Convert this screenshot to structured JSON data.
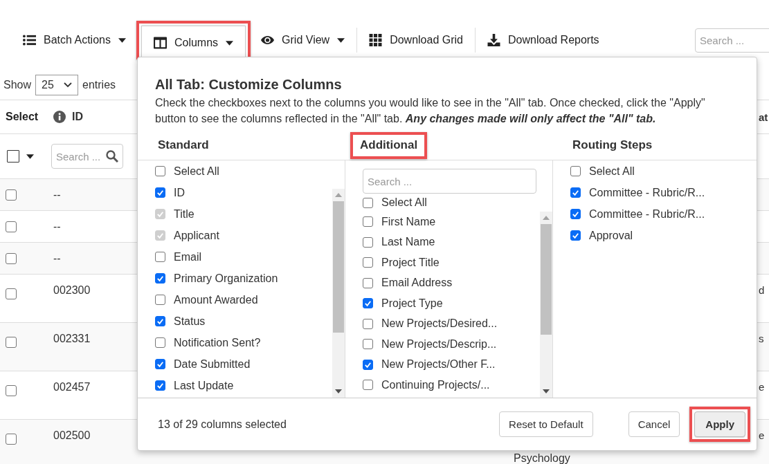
{
  "toolbar": {
    "items": [
      {
        "label": "Batch Actions",
        "caret": true,
        "highlighted": false,
        "separator": false
      },
      {
        "label": "Columns",
        "caret": true,
        "highlighted": true,
        "separator": false
      },
      {
        "label": "Grid View",
        "caret": true,
        "highlighted": false,
        "separator": false
      },
      {
        "label": "Download Grid",
        "caret": false,
        "highlighted": false,
        "separator": true
      },
      {
        "label": "Download Reports",
        "caret": false,
        "highlighted": false,
        "separator": true
      }
    ],
    "search": {
      "placeholder": "Search ..."
    }
  },
  "length_menu": {
    "prefix": "Show",
    "value": "25",
    "suffix": "entries"
  },
  "table": {
    "header": {
      "select": "Select",
      "id": "ID",
      "column_4": "at"
    },
    "filter": {
      "checked": false,
      "placeholder": "Search ..."
    },
    "rows": [
      {
        "checked": false,
        "id": "--"
      },
      {
        "checked": false,
        "id": "--"
      },
      {
        "checked": false,
        "id": "--"
      },
      {
        "checked": false,
        "id": "002300",
        "column_4": "d"
      },
      {
        "checked": false,
        "id": "002331",
        "column_4": "s"
      },
      {
        "checked": false,
        "id": "002457",
        "column_4": "e"
      },
      {
        "checked": false,
        "id": "002500",
        "column_3": "Psychology",
        "column_4": "e"
      }
    ]
  },
  "dialog": {
    "title": "All Tab: Customize Columns",
    "description": "Check the checkboxes next to the columns you would like to see in the \"All\" tab. Once checked, click the \"Apply\" button to see the columns reflected in the \"All\" tab. **Any changes made will only affect the \"All\" tab.**",
    "columns": [
      {
        "heading": "Standard",
        "highlighted": false,
        "select_all": {
          "label": "Select All",
          "checked": false
        },
        "items": [
          {
            "label": "ID",
            "checked": true,
            "disabled": false
          },
          {
            "label": "Title",
            "checked": true,
            "disabled": true
          },
          {
            "label": "Applicant",
            "checked": true,
            "disabled": true
          },
          {
            "label": "Email",
            "checked": false,
            "disabled": false
          },
          {
            "label": "Primary Organization",
            "checked": true,
            "disabled": false
          },
          {
            "label": "Amount Awarded",
            "checked": false,
            "disabled": false
          },
          {
            "label": "Status",
            "checked": true,
            "disabled": false
          },
          {
            "label": "Notification Sent?",
            "checked": false,
            "disabled": false
          },
          {
            "label": "Date Submitted",
            "checked": true,
            "disabled": false
          },
          {
            "label": "Last Update",
            "checked": true,
            "disabled": false
          }
        ]
      },
      {
        "heading": "Additional",
        "highlighted": true,
        "search": {
          "placeholder": "Search ..."
        },
        "select_all": {
          "label": "Select All",
          "checked": false
        },
        "items": [
          {
            "label": "First Name",
            "checked": false,
            "disabled": false
          },
          {
            "label": "Last Name",
            "checked": false,
            "disabled": false
          },
          {
            "label": "Project Title",
            "checked": false,
            "disabled": false
          },
          {
            "label": "Email Address",
            "checked": false,
            "disabled": false
          },
          {
            "label": "Project Type",
            "checked": true,
            "disabled": false
          },
          {
            "label": "New Projects/Desired...",
            "checked": false,
            "disabled": false
          },
          {
            "label": "New Projects/Descrip...",
            "checked": false,
            "disabled": false
          },
          {
            "label": "New Projects/Other F...",
            "checked": true,
            "disabled": false
          },
          {
            "label": "Continuing Projects/...",
            "checked": false,
            "disabled": false
          }
        ]
      },
      {
        "heading": "Routing Steps",
        "highlighted": false,
        "select_all": {
          "label": "Select All",
          "checked": false
        },
        "items": [
          {
            "label": "Committee - Rubric/R...",
            "checked": true,
            "disabled": false
          },
          {
            "label": "Committee - Rubric/R...",
            "checked": true,
            "disabled": false
          },
          {
            "label": "Approval",
            "checked": true,
            "disabled": false
          }
        ]
      }
    ],
    "footer": {
      "summary": "13 of 29 columns selected",
      "buttons": [
        {
          "label": "Reset to Default",
          "kind": "default",
          "highlighted": false
        },
        {
          "label": "Cancel",
          "kind": "default",
          "highlighted": false
        },
        {
          "label": "Apply",
          "kind": "primary",
          "highlighted": true
        }
      ]
    }
  }
}
